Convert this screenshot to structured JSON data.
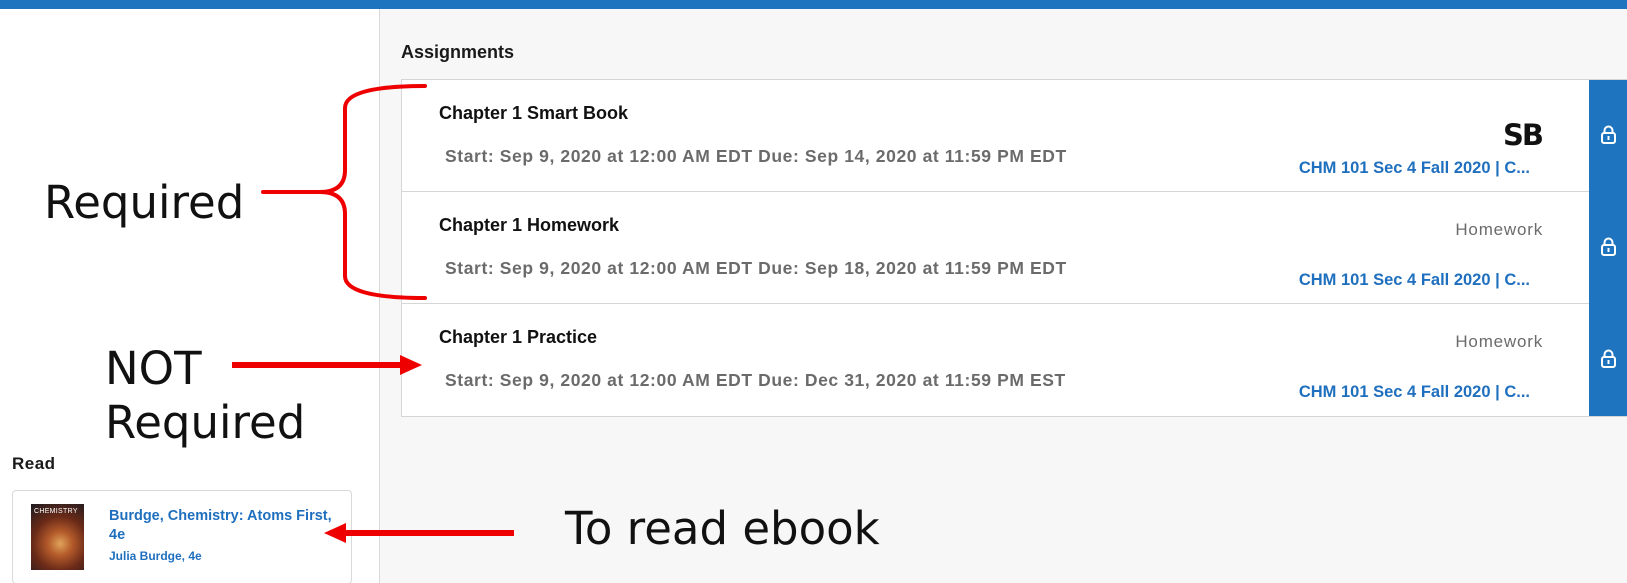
{
  "assignments": {
    "section_title": "Assignments",
    "items": [
      {
        "title": "Chapter 1 Smart Book",
        "dates": "Start: Sep 9, 2020 at 12:00 AM EDT  Due: Sep 14, 2020 at 11:59 PM EDT",
        "type_badge": "SB",
        "course": "CHM 101 Sec 4 Fall 2020 | C..."
      },
      {
        "title": "Chapter 1 Homework",
        "dates": "Start: Sep 9, 2020 at 12:00 AM EDT  Due: Sep 18, 2020 at 11:59 PM EDT",
        "type": "Homework",
        "course": "CHM 101 Sec 4 Fall 2020 | C..."
      },
      {
        "title": "Chapter 1 Practice",
        "dates": "Start: Sep 9, 2020 at 12:00 AM EDT  Due: Dec 31, 2020 at 11:59 PM EST",
        "type": "Homework",
        "course": "CHM 101 Sec 4 Fall 2020 | C..."
      }
    ]
  },
  "read": {
    "section_title": "Read",
    "book": {
      "cover_label": "CHEMISTRY",
      "title": "Burdge, Chemistry: Atoms First, 4e",
      "author": "Julia Burdge, 4e"
    }
  },
  "annotations": {
    "required": "Required",
    "not_line1": "NOT",
    "not_line2": "Required",
    "read_ebook": "To read ebook"
  },
  "colors": {
    "brand_blue": "#1f74c0",
    "link_blue": "#1f6fbf",
    "annotation_red": "#ee0000"
  },
  "icons": {
    "lock": "lock-icon",
    "smartbook": "smartbook-logo"
  }
}
